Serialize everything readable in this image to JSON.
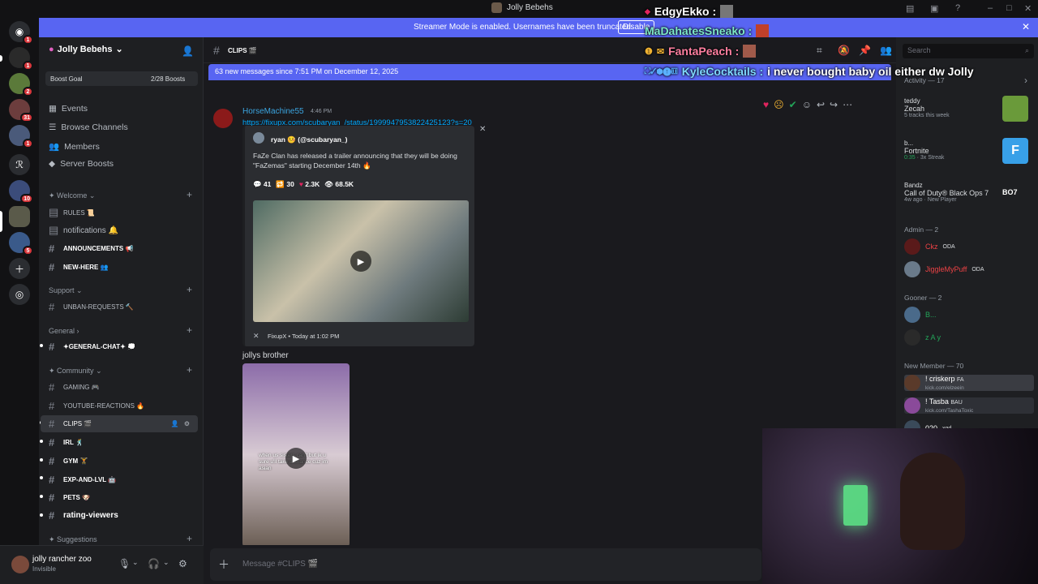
{
  "window": {
    "title": "Jolly Bebehs"
  },
  "banner": {
    "text": "Streamer Mode is enabled. Usernames have been truncated.",
    "disable": "Disable"
  },
  "servers": [
    {
      "badge": "1"
    },
    {
      "badge": "1"
    },
    {
      "badge": "2"
    },
    {
      "badge": "31"
    },
    {
      "badge": "1"
    },
    {
      "badge": ""
    },
    {
      "badge": "10"
    },
    {
      "badge": ""
    },
    {
      "badge": "5"
    }
  ],
  "sidebar": {
    "server_name": "Jolly Bebehs",
    "boost_goal": "Boost Goal",
    "boost_count": "2/28 Boosts",
    "nav": [
      "Events",
      "Browse Channels",
      "Members",
      "Server Boosts"
    ],
    "categories": {
      "welcome": "Welcome",
      "support": "Support",
      "general": "General",
      "community": "Community",
      "suggestions": "Suggestions"
    },
    "channels": {
      "rules": "RULES 📜",
      "notifications": "notifications 🔔",
      "announcements": "ANNOUNCEMENTS 📢",
      "new_here": "NEW-HERE 👥",
      "unban": "UNBAN-REQUESTS 🔨",
      "general_chat": "✦GENERAL-CHAT✦ 💭",
      "gaming": "GAMING 🎮",
      "youtube": "YOUTUBE-REACTIONS 🔥",
      "clips": "CLIPS 🎬",
      "irl": "IRL 🕺",
      "gym": "GYM 🏋",
      "exp": "EXP-AND-LVL 🤖",
      "pets": "PETS 🐶",
      "rating": "rating-viewers"
    }
  },
  "user": {
    "name": "jolly rancher zoo",
    "status": "Invisible"
  },
  "chat": {
    "channel": "CLIPS 🎬",
    "new_messages": "63 new messages since 7:51 PM on December 12, 2025",
    "message": {
      "author": "HorseMachine55",
      "time": "4:46 PM",
      "link": "https://fixupx.com/scubaryan_/status/1999947953822425123?s=20"
    },
    "embed": {
      "author": "ryan 🤒 (@scubaryan_)",
      "text": "FaZe Clan has released a trailer announcing that they will be doing \"FaZemas\" starting December 14th 🔥",
      "replies": "41",
      "retweets": "30",
      "likes": "2.3K",
      "views": "68.5K",
      "footer": "FixupX • Today at 1:02 PM"
    },
    "caption": "jollys brother",
    "video_caption": "when us sisters can't but ik u sure u'll take a chance cuz im asian",
    "composer_placeholder": "Message #CLIPS 🎬"
  },
  "right": {
    "search": "Search",
    "activity_header": "Activity — 17",
    "activities": [
      {
        "user": "teddy",
        "title": "Zecah",
        "detail": "5 tracks this week"
      },
      {
        "user": "b...",
        "title": "Fortnite",
        "detail": "0:35",
        "extra": "3x Streak"
      },
      {
        "user": "Bandz",
        "title": "Call of Duty® Black Ops 7",
        "detail": "4w ago",
        "extra": "New Player"
      }
    ],
    "groups": [
      {
        "name": "Admin — 2",
        "members": [
          {
            "name": "Ckz",
            "tag": "ODA"
          },
          {
            "name": "JiggleMyPuff",
            "tag": "ODA"
          }
        ]
      },
      {
        "name": "Gooner — 2",
        "members": [
          {
            "name": "B...",
            "tag": ""
          },
          {
            "name": "z A y",
            "tag": ""
          }
        ]
      },
      {
        "name": "New Member — 70",
        "members": [
          {
            "name": "! criskerp",
            "tag": "FA",
            "sub": "kick.com/elzeein"
          },
          {
            "name": "! Tasba",
            "tag": "BAU",
            "sub": "kick.com/TashaToxic"
          },
          {
            "name": "020",
            "tag": "xgd",
            "sub": ""
          }
        ]
      }
    ]
  },
  "overlay_chat": [
    {
      "user": "EdgyEkko :",
      "msg": ""
    },
    {
      "user": "MaDahatesSneako :",
      "msg": ""
    },
    {
      "user": "FantaPeach :",
      "msg": ""
    },
    {
      "user": "KyleCocktails :",
      "msg": "i never bought baby oil either dw Jolly"
    }
  ],
  "colors": {
    "blurple": "#5865f2",
    "link": "#00a8fc"
  }
}
